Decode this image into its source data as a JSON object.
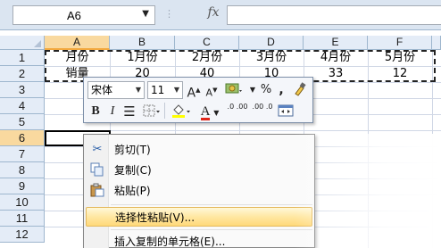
{
  "formula_bar": {
    "name_box": "A6",
    "fx_label": "fx",
    "formula": ""
  },
  "columns": [
    "A",
    "B",
    "C",
    "D",
    "E",
    "F"
  ],
  "rows": [
    "1",
    "2",
    "3",
    "4",
    "5",
    "6",
    "7",
    "8",
    "9",
    "10",
    "11",
    "12"
  ],
  "selected_column": "A",
  "selected_row": "6",
  "cells": {
    "row1": [
      "月份",
      "1月份",
      "2月份",
      "3月份",
      "4月份",
      "5月份"
    ],
    "row2": [
      "销量",
      "20",
      "40",
      "10",
      "33",
      "12"
    ]
  },
  "mini_toolbar": {
    "font_name": "宋体",
    "font_size": "11",
    "grow_font": "A",
    "shrink_font": "A",
    "percent": "%",
    "comma": ",",
    "bold": "B",
    "italic": "I",
    "font_color": "A",
    "increase_decimal": ".0 .00",
    "decrease_decimal": ".00 .0"
  },
  "context_menu": {
    "items": [
      {
        "label": "剪切(T)",
        "icon": "scissors-icon"
      },
      {
        "label": "复制(C)",
        "icon": "copy-icon"
      },
      {
        "label": "粘贴(P)",
        "icon": "paste-icon"
      },
      {
        "label": "选择性粘贴(V)...",
        "icon": ""
      },
      {
        "label": "插入复制的单元格(E)...",
        "icon": ""
      }
    ],
    "highlighted_index": 3
  },
  "colors": {
    "header_bg": "#e4ecf7",
    "selected_header": "#f9d99f",
    "menu_highlight": "#ffe7a2",
    "font_color_red": "#e0261a",
    "fill_yellow": "#ffff00"
  }
}
